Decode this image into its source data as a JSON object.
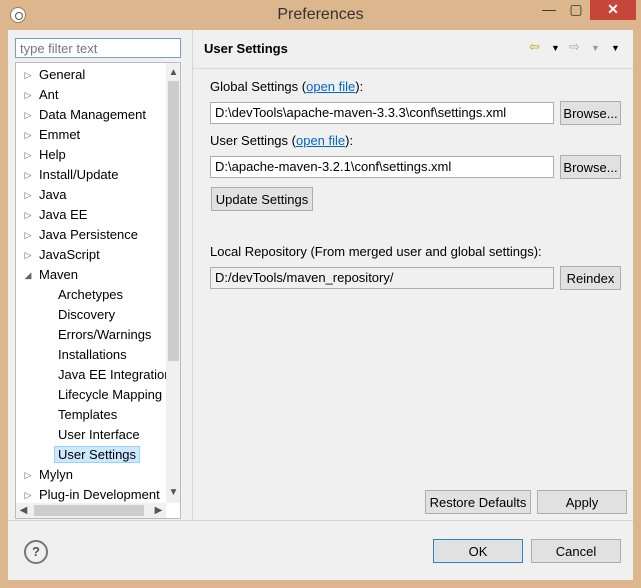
{
  "window": {
    "title": "Preferences"
  },
  "filter": {
    "placeholder": "type filter text"
  },
  "tree": {
    "items": [
      {
        "label": "General",
        "expanded": false
      },
      {
        "label": "Ant",
        "expanded": false
      },
      {
        "label": "Data Management",
        "expanded": false
      },
      {
        "label": "Emmet",
        "expanded": false
      },
      {
        "label": "Help",
        "expanded": false
      },
      {
        "label": "Install/Update",
        "expanded": false
      },
      {
        "label": "Java",
        "expanded": false
      },
      {
        "label": "Java EE",
        "expanded": false
      },
      {
        "label": "Java Persistence",
        "expanded": false
      },
      {
        "label": "JavaScript",
        "expanded": false
      },
      {
        "label": "Maven",
        "expanded": true
      },
      {
        "label": "Archetypes"
      },
      {
        "label": "Discovery"
      },
      {
        "label": "Errors/Warnings"
      },
      {
        "label": "Installations"
      },
      {
        "label": "Java EE Integration"
      },
      {
        "label": "Lifecycle Mapping"
      },
      {
        "label": "Templates"
      },
      {
        "label": "User Interface"
      },
      {
        "label": "User Settings",
        "selected": true
      },
      {
        "label": "Mylyn",
        "expanded": false
      },
      {
        "label": "Plug-in Development",
        "expanded": false
      }
    ]
  },
  "page": {
    "title": "User Settings",
    "global_label": "Global Settings (",
    "global_link": "open file",
    "global_suffix": "):",
    "global_path": "D:\\devTools\\apache-maven-3.3.3\\conf\\settings.xml",
    "user_label": "User Settings (",
    "user_link": "open file",
    "user_suffix": "):",
    "user_path": "D:\\apache-maven-3.2.1\\conf\\settings.xml",
    "browse": "Browse...",
    "update_settings": "Update Settings",
    "local_repo_label": "Local Repository (From merged user and global settings):",
    "local_repo_path": "D:/devTools/maven_repository/",
    "reindex": "Reindex",
    "restore_defaults": "Restore Defaults",
    "apply": "Apply"
  },
  "dialog": {
    "ok": "OK",
    "cancel": "Cancel"
  },
  "icons": {
    "back": "arrow-left-icon",
    "forward": "arrow-right-icon",
    "menu": "chevron-down-icon",
    "help": "help-icon"
  }
}
